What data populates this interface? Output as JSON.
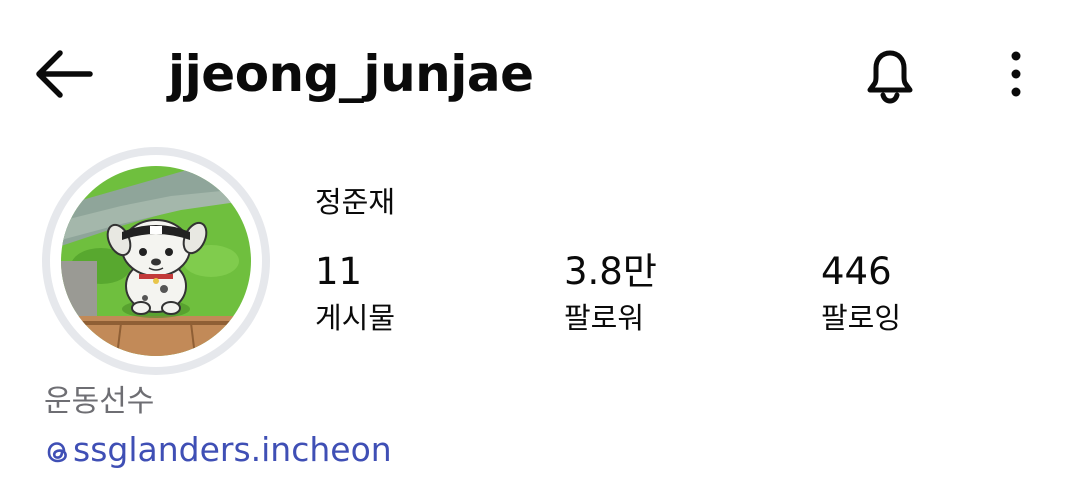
{
  "header": {
    "username": "jjeong_junjae",
    "icons": {
      "back": "arrow-left-icon",
      "notifications": "bell-icon",
      "more": "more-vertical-icon"
    }
  },
  "profile": {
    "full_name": "정준재",
    "stats": [
      {
        "value": "11",
        "label": "게시물"
      },
      {
        "value": "3.8만",
        "label": "팔로워"
      },
      {
        "value": "446",
        "label": "팔로잉"
      }
    ],
    "category": "운동선수",
    "threads_handle": "ssglanders.incheon",
    "threads_icon": "threads-icon"
  },
  "colors": {
    "text": "#0a0a0a",
    "muted": "#6e6e73",
    "link": "#3f4fb5",
    "avatar_ring": "#e6e8ec"
  }
}
